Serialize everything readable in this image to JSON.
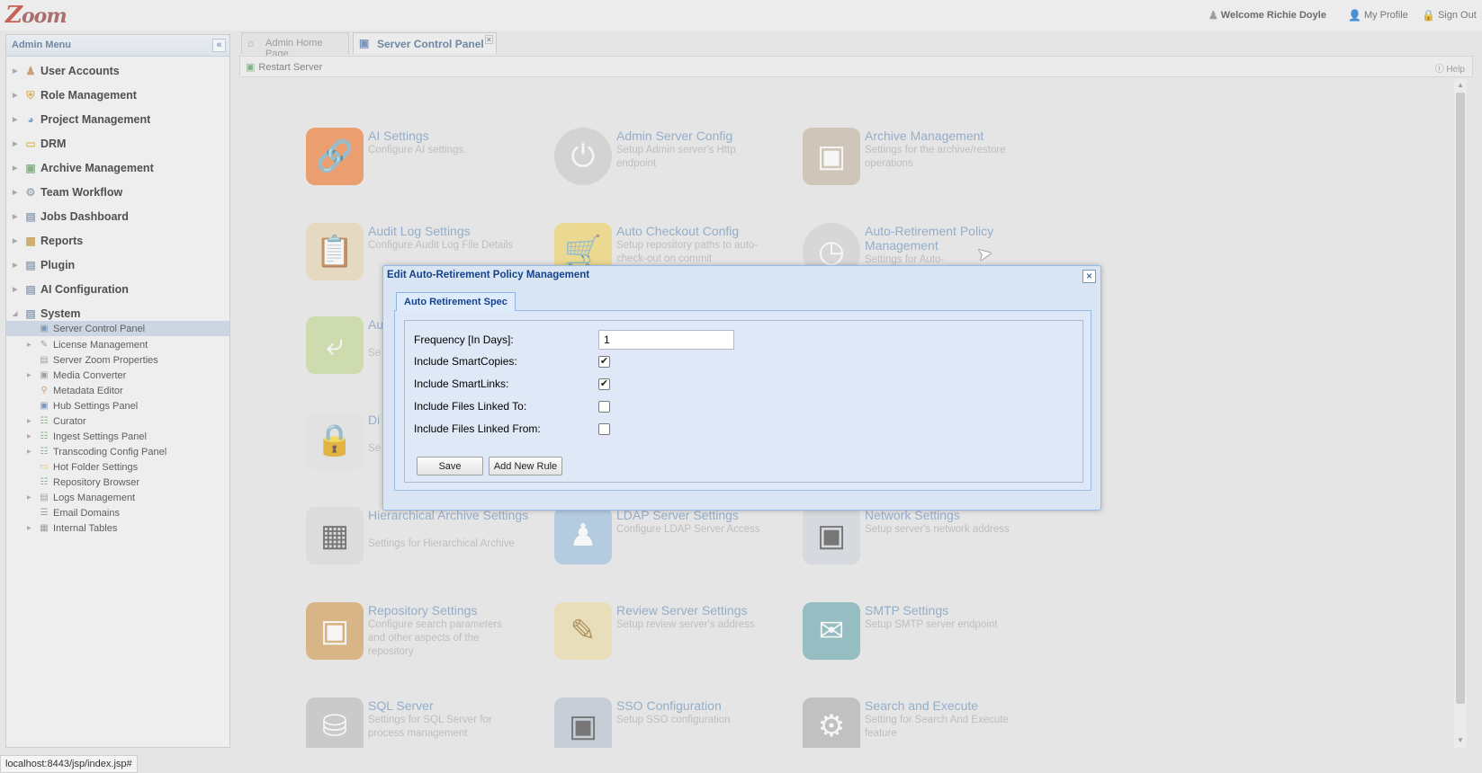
{
  "app": {
    "logo_text": "Zoom"
  },
  "header": {
    "welcome": "Welcome Richie Doyle",
    "my_profile": "My Profile",
    "sign_out": "Sign Out"
  },
  "sidebar": {
    "title": "Admin Menu",
    "items": [
      {
        "label": "User Accounts",
        "icon": "user-icon"
      },
      {
        "label": "Role Management",
        "icon": "shield-icon"
      },
      {
        "label": "Project Management",
        "icon": "pie-chart-icon"
      },
      {
        "label": "DRM",
        "icon": "folder-icon"
      },
      {
        "label": "Archive Management",
        "icon": "archive-icon"
      },
      {
        "label": "Team Workflow",
        "icon": "workflow-icon"
      },
      {
        "label": "Jobs Dashboard",
        "icon": "dashboard-icon"
      },
      {
        "label": "Reports",
        "icon": "report-icon"
      },
      {
        "label": "Plugin",
        "icon": "plugin-icon"
      },
      {
        "label": "AI Configuration",
        "icon": "ai-config-icon"
      },
      {
        "label": "System",
        "icon": "system-icon"
      }
    ],
    "system_children": [
      {
        "label": "Server Control Panel",
        "icon": "monitor-icon"
      },
      {
        "label": "License Management",
        "icon": "license-icon"
      },
      {
        "label": "Server Zoom Properties",
        "icon": "properties-icon"
      },
      {
        "label": "Media Converter",
        "icon": "media-icon"
      },
      {
        "label": "Metadata Editor",
        "icon": "metadata-icon"
      },
      {
        "label": "Hub Settings Panel",
        "icon": "hub-icon"
      },
      {
        "label": "Curator",
        "icon": "tree-icon"
      },
      {
        "label": "Ingest Settings Panel",
        "icon": "tree-icon"
      },
      {
        "label": "Transcoding Config Panel",
        "icon": "tree-icon"
      },
      {
        "label": "Hot Folder Settings",
        "icon": "folder-icon"
      },
      {
        "label": "Repository Browser",
        "icon": "tree-icon"
      },
      {
        "label": "Logs Management",
        "icon": "logs-icon"
      },
      {
        "label": "Email Domains",
        "icon": "list-icon"
      },
      {
        "label": "Internal Tables",
        "icon": "table-icon"
      }
    ]
  },
  "tabs": {
    "home": "Admin Home Page",
    "server_control": "Server Control Panel"
  },
  "toolbar": {
    "restart": "Restart Server",
    "help": "Help"
  },
  "tiles": [
    {
      "title": "AI Settings",
      "desc": "Configure AI settings.",
      "icon": "link-icon",
      "color": "#f08a4b"
    },
    {
      "title": "Admin Server Config",
      "desc": "Setup Admin server's Http endpoint",
      "icon": "power-icon",
      "color": "#d0d0d0"
    },
    {
      "title": "Archive Management",
      "desc": "Settings for the archive/restore operations",
      "icon": "box-icon",
      "color": "#cbbfae"
    },
    {
      "title": "Audit Log Settings",
      "desc": "Configure Audit Log File Details",
      "icon": "clipboard-icon",
      "color": "#e8d9b8"
    },
    {
      "title": "Auto Checkout Config",
      "desc": "Setup repository paths to auto-check-out on commit",
      "icon": "cart-icon",
      "color": "#f0d878"
    },
    {
      "title": "Auto-Retirement Policy Management",
      "desc": "Settings for Auto-",
      "icon": "gauge-icon",
      "color": "#d6d6d6"
    },
    {
      "title": "Au",
      "desc": "Se",
      "icon": "arrow-icon",
      "color": "#c8dba0"
    },
    {
      "title": "Di",
      "desc": "Se",
      "icon": "lock-doc-icon",
      "color": "#e4e4e4"
    },
    {
      "title": "Hierarchical Archive Settings",
      "desc": "Settings for Hierarchical Archive",
      "icon": "hierarchy-icon",
      "color": "#dcdcdc"
    },
    {
      "title": "LDAP Server Settings",
      "desc": "Configure LDAP Server Access",
      "icon": "ldap-user-icon",
      "color": "#a9c6e2"
    },
    {
      "title": "Network Settings",
      "desc": "Setup server's network address",
      "icon": "network-icon",
      "color": "#d4d8de"
    },
    {
      "title": "Repository Settings",
      "desc": "Configure search parameters and other aspects of the repository",
      "icon": "crate-icon",
      "color": "#d7a96b"
    },
    {
      "title": "Review Server Settings",
      "desc": "Setup review server's address",
      "icon": "pencil-paper-icon",
      "color": "#ecdfae"
    },
    {
      "title": "SMTP Settings",
      "desc": "Setup SMTP server endpoint",
      "icon": "mail-icon",
      "color": "#7fb3b8"
    },
    {
      "title": "SQL Server",
      "desc": "Settings for SQL Server for process management",
      "icon": "database-icon",
      "color": "#c4c4c4"
    },
    {
      "title": "SSO Configuration",
      "desc": "Setup SSO configuration",
      "icon": "sso-icon",
      "color": "#bfc9d6"
    },
    {
      "title": "Search and Execute",
      "desc": "Setting for Search And Execute feature",
      "icon": "gear-icon",
      "color": "#b8b8b8"
    }
  ],
  "dialog": {
    "title": "Edit Auto-Retirement Policy Management",
    "tab": "Auto Retirement Spec",
    "fields": {
      "frequency_label": "Frequency [In Days]:",
      "frequency_value": "1",
      "smartcopies_label": "Include SmartCopies:",
      "smartcopies_checked": true,
      "smartlinks_label": "Include SmartLinks:",
      "smartlinks_checked": true,
      "linked_to_label": "Include Files Linked To:",
      "linked_to_checked": false,
      "linked_from_label": "Include Files Linked From:",
      "linked_from_checked": false
    },
    "save_label": "Save",
    "add_rule_label": "Add New Rule"
  },
  "status_bar": {
    "url": "localhost:8443/jsp/index.jsp#"
  }
}
